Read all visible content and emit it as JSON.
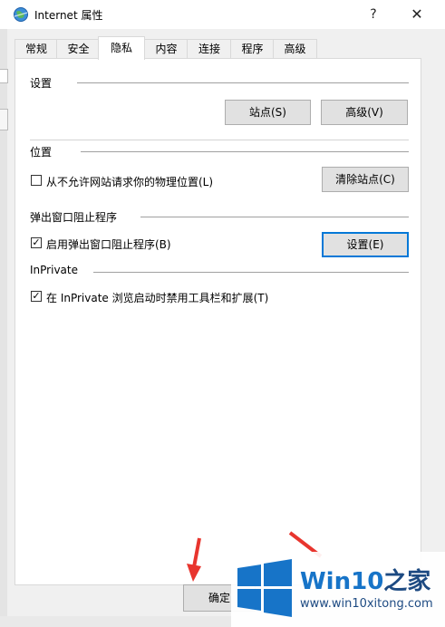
{
  "window": {
    "title": "Internet 属性",
    "help_glyph": "?",
    "close_glyph": "✕"
  },
  "tabs": [
    {
      "label": "常规"
    },
    {
      "label": "安全"
    },
    {
      "label": "隐私",
      "active": true
    },
    {
      "label": "内容"
    },
    {
      "label": "连接"
    },
    {
      "label": "程序"
    },
    {
      "label": "高级"
    }
  ],
  "settings_section": {
    "title": "设置",
    "sites_button": "站点(S)",
    "advanced_button": "高级(V)"
  },
  "location_section": {
    "title": "位置",
    "checkbox_label": "从不允许网站请求你的物理位置(L)",
    "checkbox_checked": false,
    "clear_sites_button": "清除站点(C)"
  },
  "popup_section": {
    "title": "弹出窗口阻止程序",
    "checkbox_label": "启用弹出窗口阻止程序(B)",
    "checkbox_checked": true,
    "settings_button": "设置(E)"
  },
  "inprivate_section": {
    "title": "InPrivate",
    "checkbox_label": "在 InPrivate 浏览启动时禁用工具栏和扩展(T)",
    "checkbox_checked": true
  },
  "footer": {
    "ok_button": "确定"
  },
  "watermark": {
    "title_main": "Win10",
    "title_suffix": "之家",
    "url": "www.win10xitong.com"
  },
  "colors": {
    "focus_border": "#0078d7",
    "arrow_red": "#e8352e",
    "watermark_blue": "#1774c8"
  }
}
